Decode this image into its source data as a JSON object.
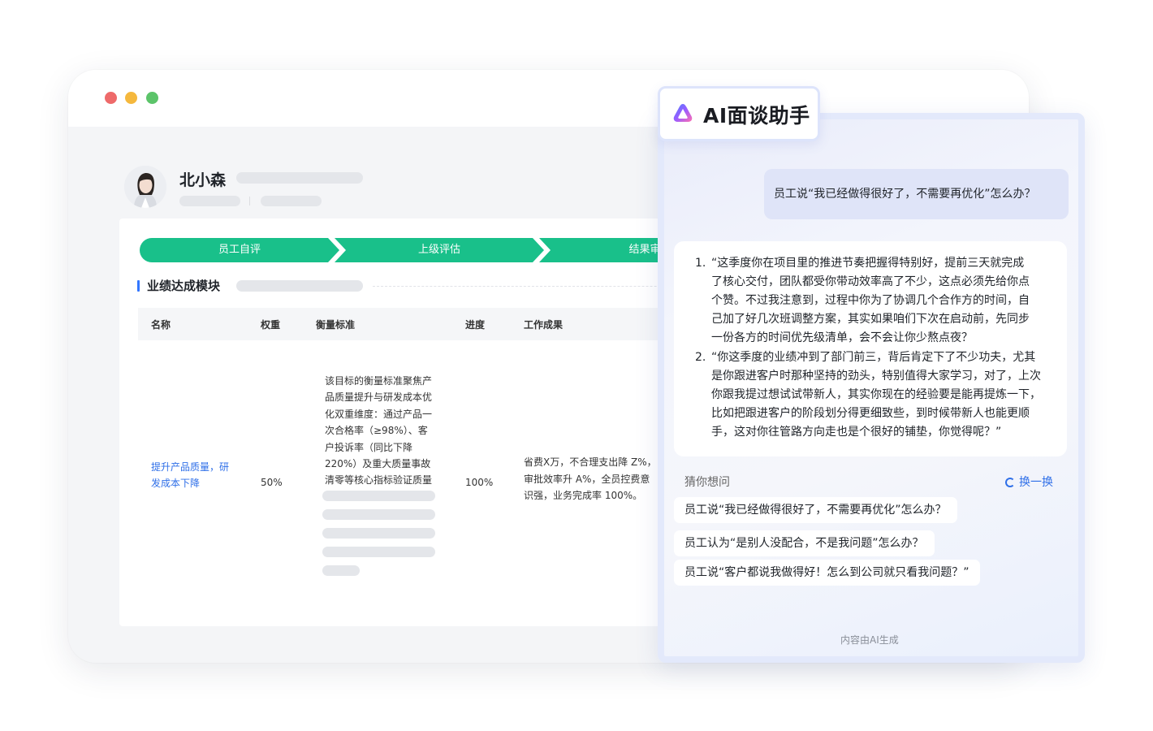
{
  "employee": {
    "name": "北小森"
  },
  "steps": [
    "员工自评",
    "上级评估",
    "结果审"
  ],
  "section": {
    "title": "业绩达成模块"
  },
  "table": {
    "headers": {
      "name": "名称",
      "weight": "权重",
      "criteria": "衡量标准",
      "progress": "进度",
      "result": "工作成果"
    },
    "row": {
      "name_line1": "提升产品质量，研",
      "name_line2": "发成本下降",
      "weight": "50%",
      "criteria": [
        "该目标的衡量标准聚焦产",
        "品质量提升与研发成本优",
        "化双重维度：通过产品一",
        "次合格率（≥98%）、客",
        "户投诉率（同比下降",
        "220%）及重大质量事故",
        "清零等核心指标验证质量"
      ],
      "progress": "100%",
      "result": [
        "省费X万，不合理支出降 Z%，",
        "审批效率升 A%，全员控费意",
        "识强，业务完成率 100%。"
      ]
    }
  },
  "ai": {
    "title": "AI面谈助手",
    "question": "员工说“我已经做得很好了，不需要再优化”怎么办？",
    "answers": [
      {
        "num": "1.",
        "lines": [
          "“这季度你在项目里的推进节奏把握得特别好，提前三天就完成",
          "了核心交付，团队都受你带动效率高了不少，这点必须先给你点",
          "个赞。不过我注意到，过程中你为了协调几个合作方的时间，自",
          "己加了好几次班调整方案，其实如果咱们下次在启动前，先同步",
          "一份各方的时间优先级清单，会不会让你少熬点夜？"
        ]
      },
      {
        "num": "2.",
        "lines": [
          "“你这季度的业绩冲到了部门前三，背后肯定下了不少功夫，尤其",
          "是你跟进客户时那种坚持的劲头，特别值得大家学习，对了，上次",
          "你跟我提过想试试带新人，其实你现在的经验要是能再提炼一下，",
          "比如把跟进客户的阶段划分得更细致些，到时候带新人也能更顺",
          "手，这对你往管路方向走也是个很好的铺垫，你觉得呢？”"
        ]
      }
    ],
    "guess_label": "猜你想问",
    "refresh_label": "换一换",
    "suggestions": [
      "员工说“我已经做得很好了，不需要再优化”怎么办？",
      "员工认为“是别人没配合，不是我问题”怎么办？",
      "员工说“客户都说我做得好！怎么到公司就只看我问题？”"
    ],
    "footer": "内容由AI生成"
  },
  "colors": {
    "accent_green": "#19c08a",
    "link_blue": "#2f6fe8",
    "section_bar": "#3377ff"
  },
  "icons": [
    "window-close-dot",
    "window-minimize-dot",
    "window-maximize-dot",
    "ai-logo-icon",
    "refresh-icon",
    "avatar-image"
  ]
}
